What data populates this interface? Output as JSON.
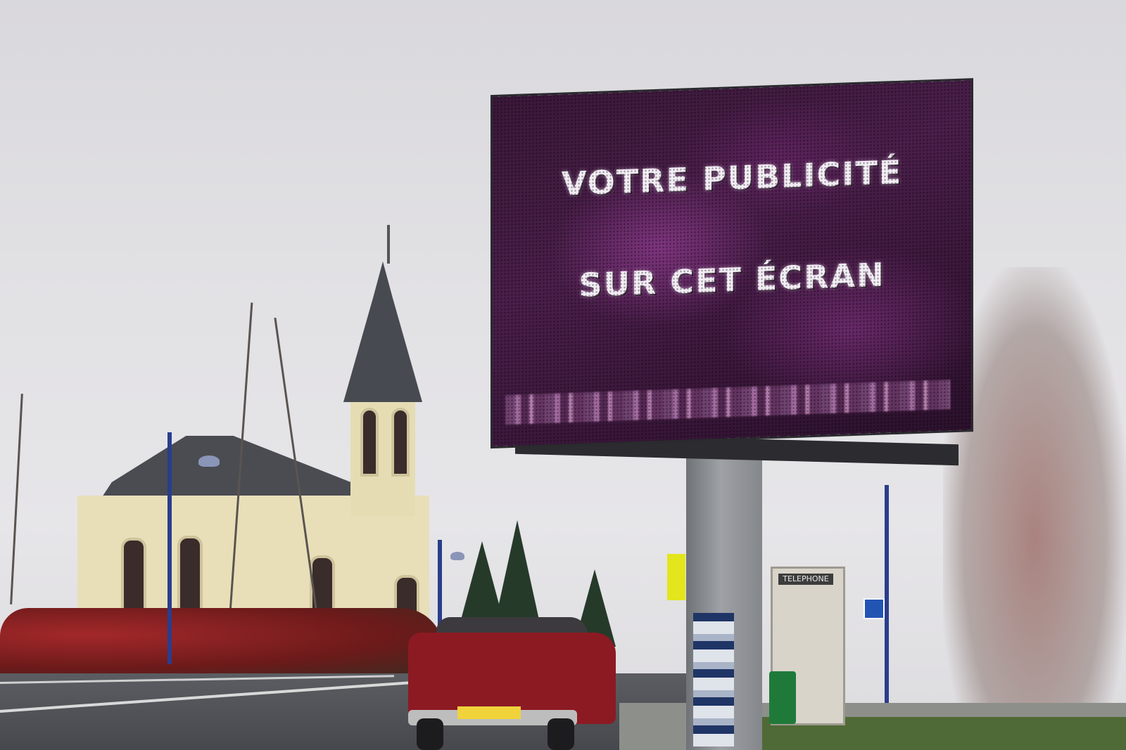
{
  "screen": {
    "line1": "VOTRE PUBLICITÉ",
    "line2": "SUR CET ÉCRAN",
    "accent_color": "#4a1f4a"
  },
  "phone_box": {
    "label": "TELEPHONE"
  },
  "colors": {
    "sky": "#e2e1e4",
    "hedge": "#a3282a",
    "car": "#8c1a22",
    "church_wall": "#e8dfb9"
  }
}
